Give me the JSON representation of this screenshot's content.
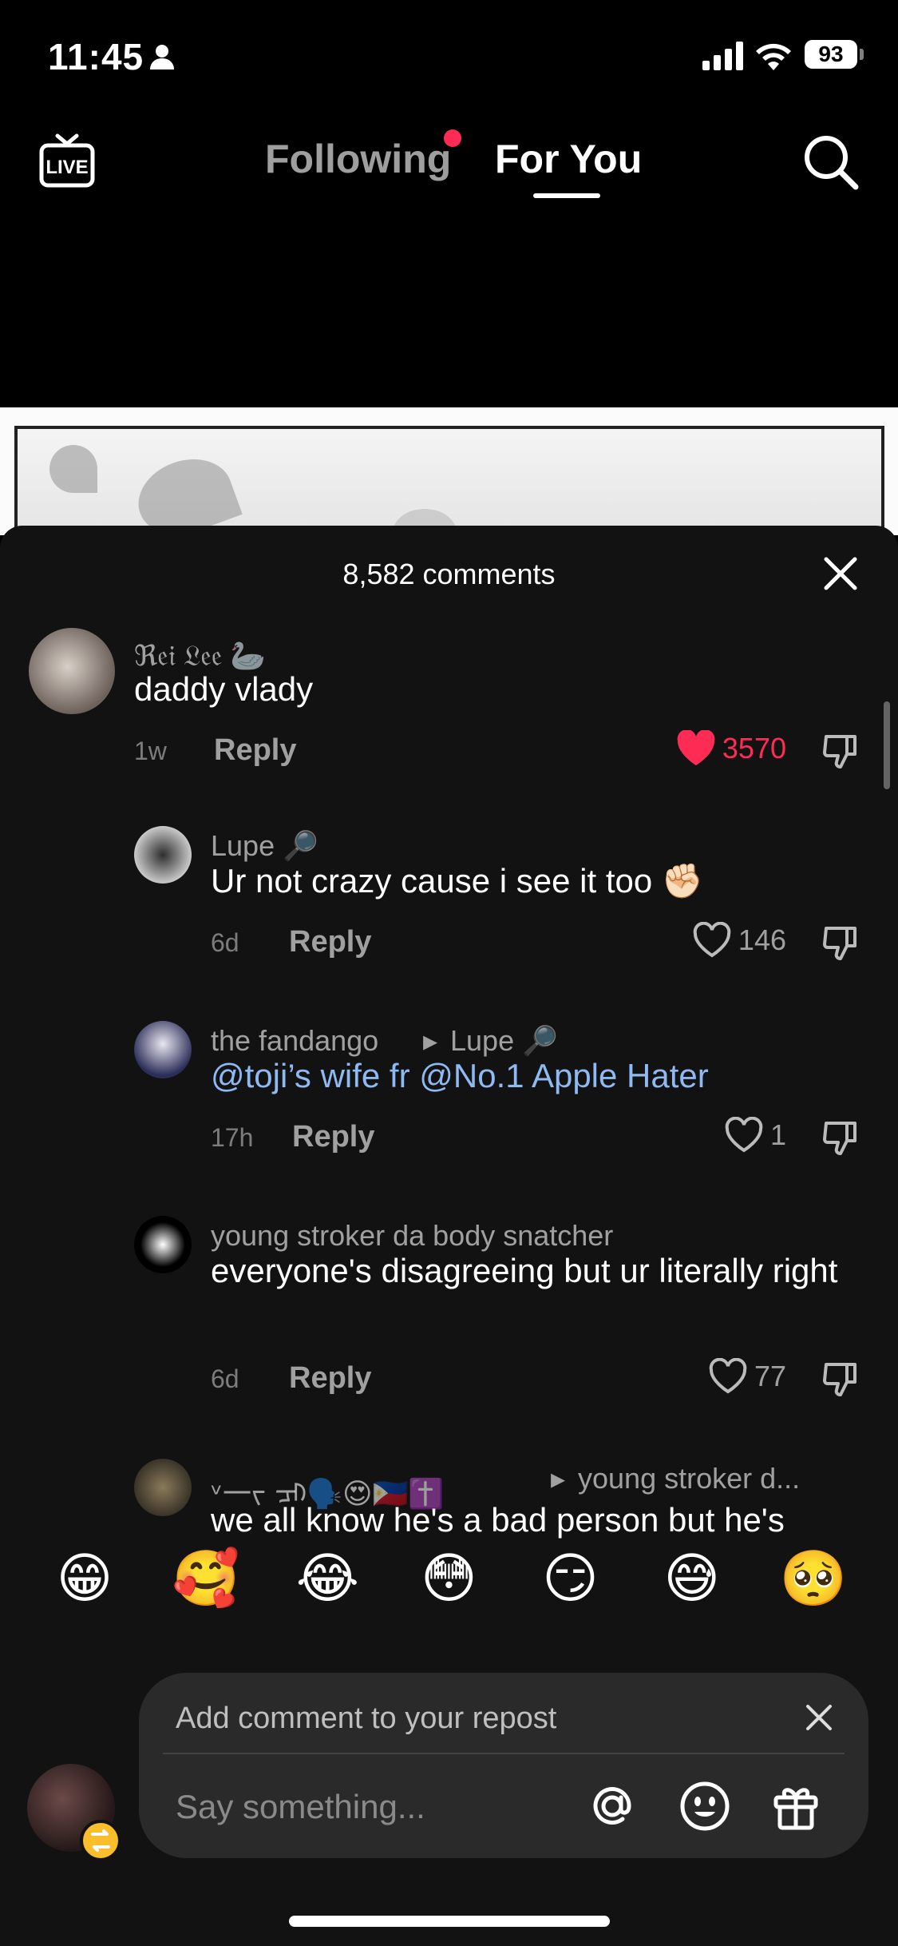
{
  "status_bar": {
    "time": "11:45",
    "battery": "93"
  },
  "top_nav": {
    "live_label": "LIVE",
    "tabs": [
      {
        "label": "Following",
        "has_dot": true
      },
      {
        "label": "For You",
        "selected": true
      }
    ]
  },
  "comments_sheet": {
    "title": "8,582 comments",
    "comments": [
      {
        "user": "ℜ𝔢𝔦 𝔏𝔢𝔢 🦢",
        "text": "daddy vlady",
        "time": "1w",
        "reply_label": "Reply",
        "likes": "3570",
        "liked": true
      },
      {
        "user": "Lupe 🔎",
        "text": "Ur not crazy cause i see it too ✊🏻",
        "time": "6d",
        "reply_label": "Reply",
        "likes": "146",
        "liked": false
      },
      {
        "user": "the fandango",
        "reply_to": "Lupe 🔎",
        "text": "@toji’s wife fr @No.1 Apple Hater",
        "time": "17h",
        "reply_label": "Reply",
        "likes": "1",
        "liked": false
      },
      {
        "user": "young stroker da body snatcher",
        "text": "everyone's disagreeing but ur literally right",
        "time": "6d",
        "reply_label": "Reply",
        "likes": "77",
        "liked": false
      },
      {
        "user": "ᵛ一ᡕ ᠴᡕ🗣️😍🇵🇭✝️",
        "reply_to": "young stroker d...",
        "text": "we all know he's a bad person but he's"
      }
    ]
  },
  "emoji_bar": [
    "😁",
    "🥰",
    "😂",
    "😳",
    "😏",
    "😅",
    "🥺"
  ],
  "composer": {
    "repost_label": "Add comment to your repost",
    "placeholder": "Say something..."
  },
  "colors": {
    "accent": "#fe2c55",
    "mention": "#8fb9f2",
    "sheet_bg": "#121212"
  }
}
